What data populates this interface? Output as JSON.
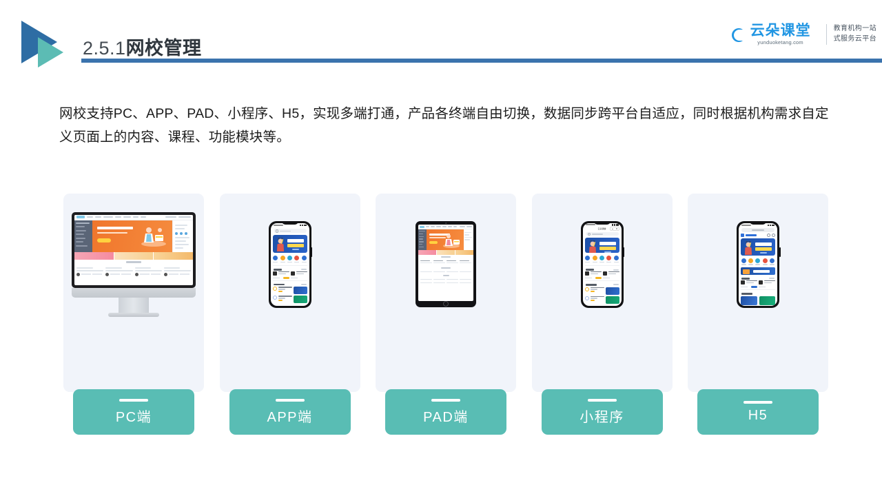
{
  "header": {
    "section_number": "2.5.1",
    "section_title": "网校管理",
    "accent_blue": "#3b73ad",
    "accent_teal": "#59bdb4"
  },
  "brand": {
    "name": "云朵课堂",
    "url": "yunduoketang.com",
    "tagline_line1": "教育机构一站",
    "tagline_line2": "式服务云平台",
    "color": "#2196e3"
  },
  "body_copy": "网校支持PC、APP、PAD、小程序、H5，实现多端打通，产品各终端自由切换，数据同步跨平台自适应，同时根据机构需求自定义页面上的内容、课程、功能模块等。",
  "cards": [
    {
      "label": "PC端",
      "device": "desktop-monitor"
    },
    {
      "label": "APP端",
      "device": "smartphone"
    },
    {
      "label": "PAD端",
      "device": "tablet"
    },
    {
      "label": "小程序",
      "device": "smartphone-miniprogram"
    },
    {
      "label": "H5",
      "device": "smartphone-h5"
    }
  ],
  "device_mockups": {
    "banner_headline_line1": "职场人的",
    "banner_headline_line2": "第一堂问诊课",
    "miniprogram_titlebar": "云朵课堂",
    "h5_brand": "云朵课堂",
    "pad_card_colors": [
      [
        "#4a4a8c",
        "#f5c842",
        "#2aa8d4",
        "#17a07a"
      ],
      [
        "#2f62b5",
        "#ef7f32",
        "#2f4470",
        "#2f8fd4"
      ],
      [
        "#f5c842",
        "#2f6fd0",
        "#17a07a",
        "#ef7f32"
      ]
    ],
    "phone_icon_colors": [
      "#2f6fd0",
      "#f5a623",
      "#2aa8d4",
      "#e8533f",
      "#2f6fd0"
    ]
  }
}
